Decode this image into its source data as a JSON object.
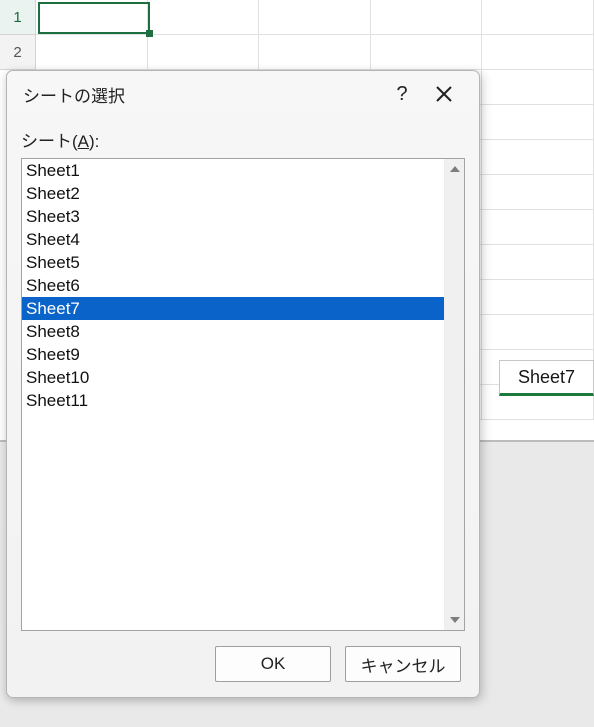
{
  "grid": {
    "row_numbers": [
      "1",
      "2"
    ]
  },
  "tabstrip": {
    "active_tab": "Sheet7"
  },
  "dialog": {
    "title": "シートの選択",
    "list_label_prefix": "シート(",
    "list_label_accel": "A",
    "list_label_suffix": "):",
    "items": [
      {
        "label": "Sheet1"
      },
      {
        "label": "Sheet2"
      },
      {
        "label": "Sheet3"
      },
      {
        "label": "Sheet4"
      },
      {
        "label": "Sheet5"
      },
      {
        "label": "Sheet6"
      },
      {
        "label": "Sheet7"
      },
      {
        "label": "Sheet8"
      },
      {
        "label": "Sheet9"
      },
      {
        "label": "Sheet10"
      },
      {
        "label": "Sheet11"
      }
    ],
    "selected_index": 6,
    "ok_label": "OK",
    "cancel_label": "キャンセル"
  }
}
